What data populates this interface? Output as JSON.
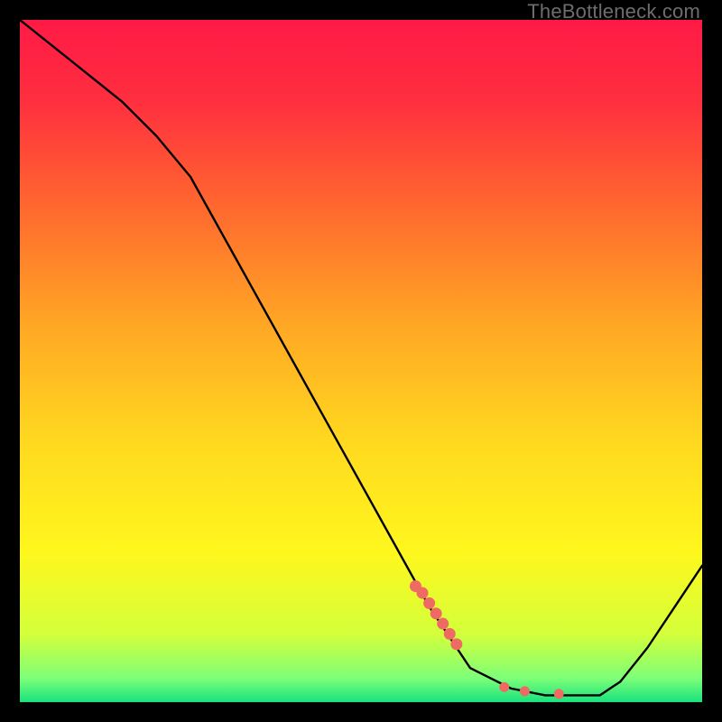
{
  "watermark": "TheBottleneck.com",
  "chart_data": {
    "type": "line",
    "title": "",
    "xlabel": "",
    "ylabel": "",
    "xlim": [
      0,
      100
    ],
    "ylim": [
      0,
      100
    ],
    "grid": false,
    "series": [
      {
        "name": "bottleneck-curve",
        "x": [
          0,
          5,
          10,
          15,
          20,
          25,
          30,
          35,
          40,
          45,
          50,
          55,
          60,
          62,
          66,
          72,
          77,
          81,
          85,
          88,
          92,
          96,
          100
        ],
        "y": [
          100,
          96,
          92,
          88,
          83,
          77,
          68,
          59,
          50,
          41,
          32,
          23,
          14,
          11,
          5,
          2,
          1,
          1,
          1,
          3,
          8,
          14,
          20
        ]
      }
    ],
    "markers": {
      "name": "highlight-points",
      "x": [
        58,
        59,
        60,
        61,
        62,
        63,
        64,
        71,
        74,
        79
      ],
      "y": [
        17,
        16,
        14.5,
        13,
        11.5,
        10,
        8.5,
        2.2,
        1.6,
        1.2
      ]
    },
    "gradient_stops": [
      {
        "offset": 0.0,
        "color": "#ff1a46"
      },
      {
        "offset": 0.12,
        "color": "#ff2f3f"
      },
      {
        "offset": 0.28,
        "color": "#ff6a2e"
      },
      {
        "offset": 0.45,
        "color": "#ffa824"
      },
      {
        "offset": 0.62,
        "color": "#ffd91f"
      },
      {
        "offset": 0.78,
        "color": "#fff71e"
      },
      {
        "offset": 0.9,
        "color": "#d4ff3a"
      },
      {
        "offset": 0.965,
        "color": "#7dff78"
      },
      {
        "offset": 1.0,
        "color": "#18e27e"
      }
    ]
  }
}
